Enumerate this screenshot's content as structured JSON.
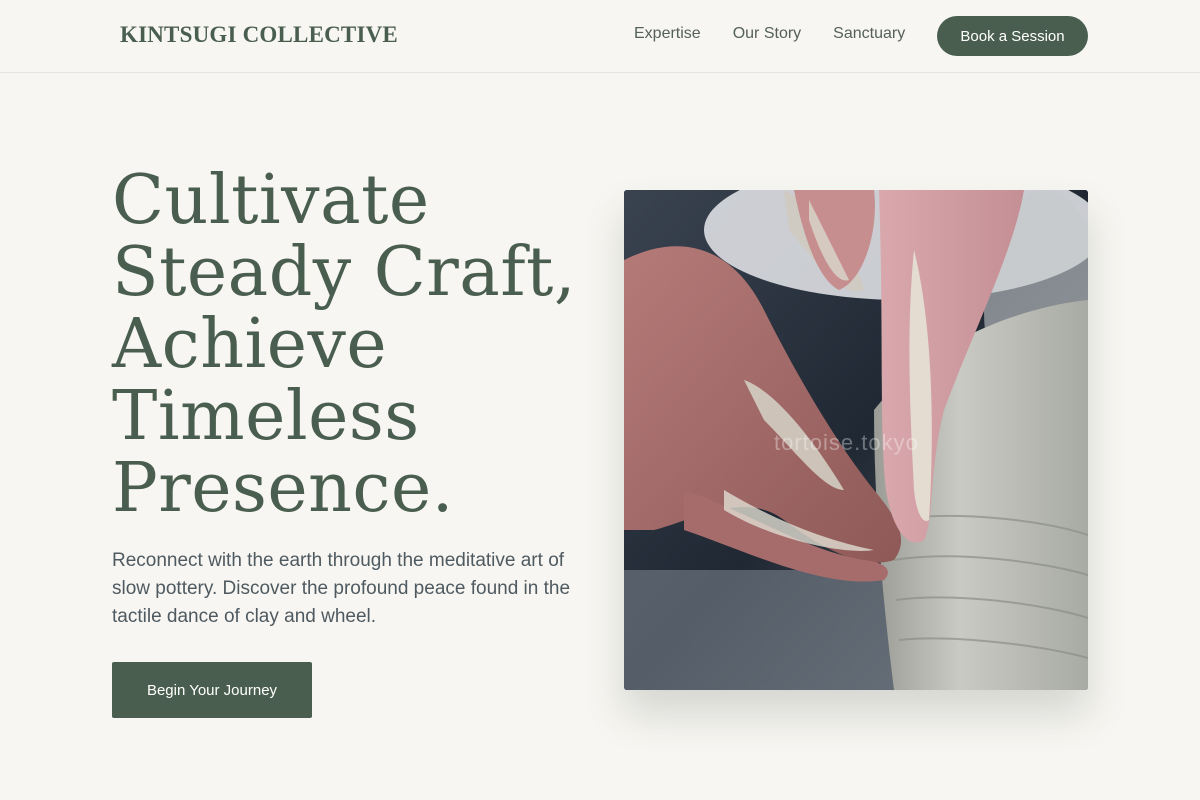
{
  "header": {
    "brand": "KINTSUGI COLLECTIVE",
    "nav": [
      "Expertise",
      "Our Story",
      "Sanctuary"
    ],
    "cta_label": "Book a Session"
  },
  "hero": {
    "title_lines": [
      "Cultivate",
      "Steady Craft,",
      "Achieve",
      "Timeless",
      "Presence."
    ],
    "description": "Reconnect with the earth through the meditative art of slow pottery. Discover the profound peace found in the tactile dance of clay and wheel.",
    "cta_label": "Begin Your Journey",
    "image": {
      "subject": "clay-covered hands shaping a pot on a pottery wheel",
      "watermark": "tortoise.tokyo"
    }
  },
  "colors": {
    "background": "#f7f6f2",
    "accent": "#4a5e4f",
    "text": "#4f5a60"
  }
}
